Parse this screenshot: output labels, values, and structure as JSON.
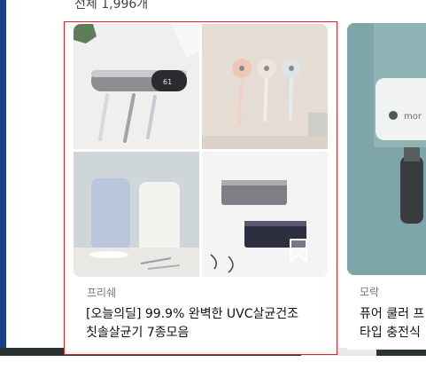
{
  "header": {
    "total_count": "전체 1,996개"
  },
  "products": [
    {
      "brand": "프리쉐",
      "title": "[오늘의딜] 99.9% 완벽한 UVC살균건조 칫솔살균기 7종모음",
      "image_icon": "product-photo",
      "bookmark_icon": "bookmark-icon",
      "selected": true
    },
    {
      "brand": "모락",
      "title": "퓨어 쿨러 프\n타입 충전식",
      "image_icon": "product-photo"
    }
  ],
  "colors": {
    "selection_outline": "#e0232a",
    "left_border": "#1b3f8c"
  }
}
